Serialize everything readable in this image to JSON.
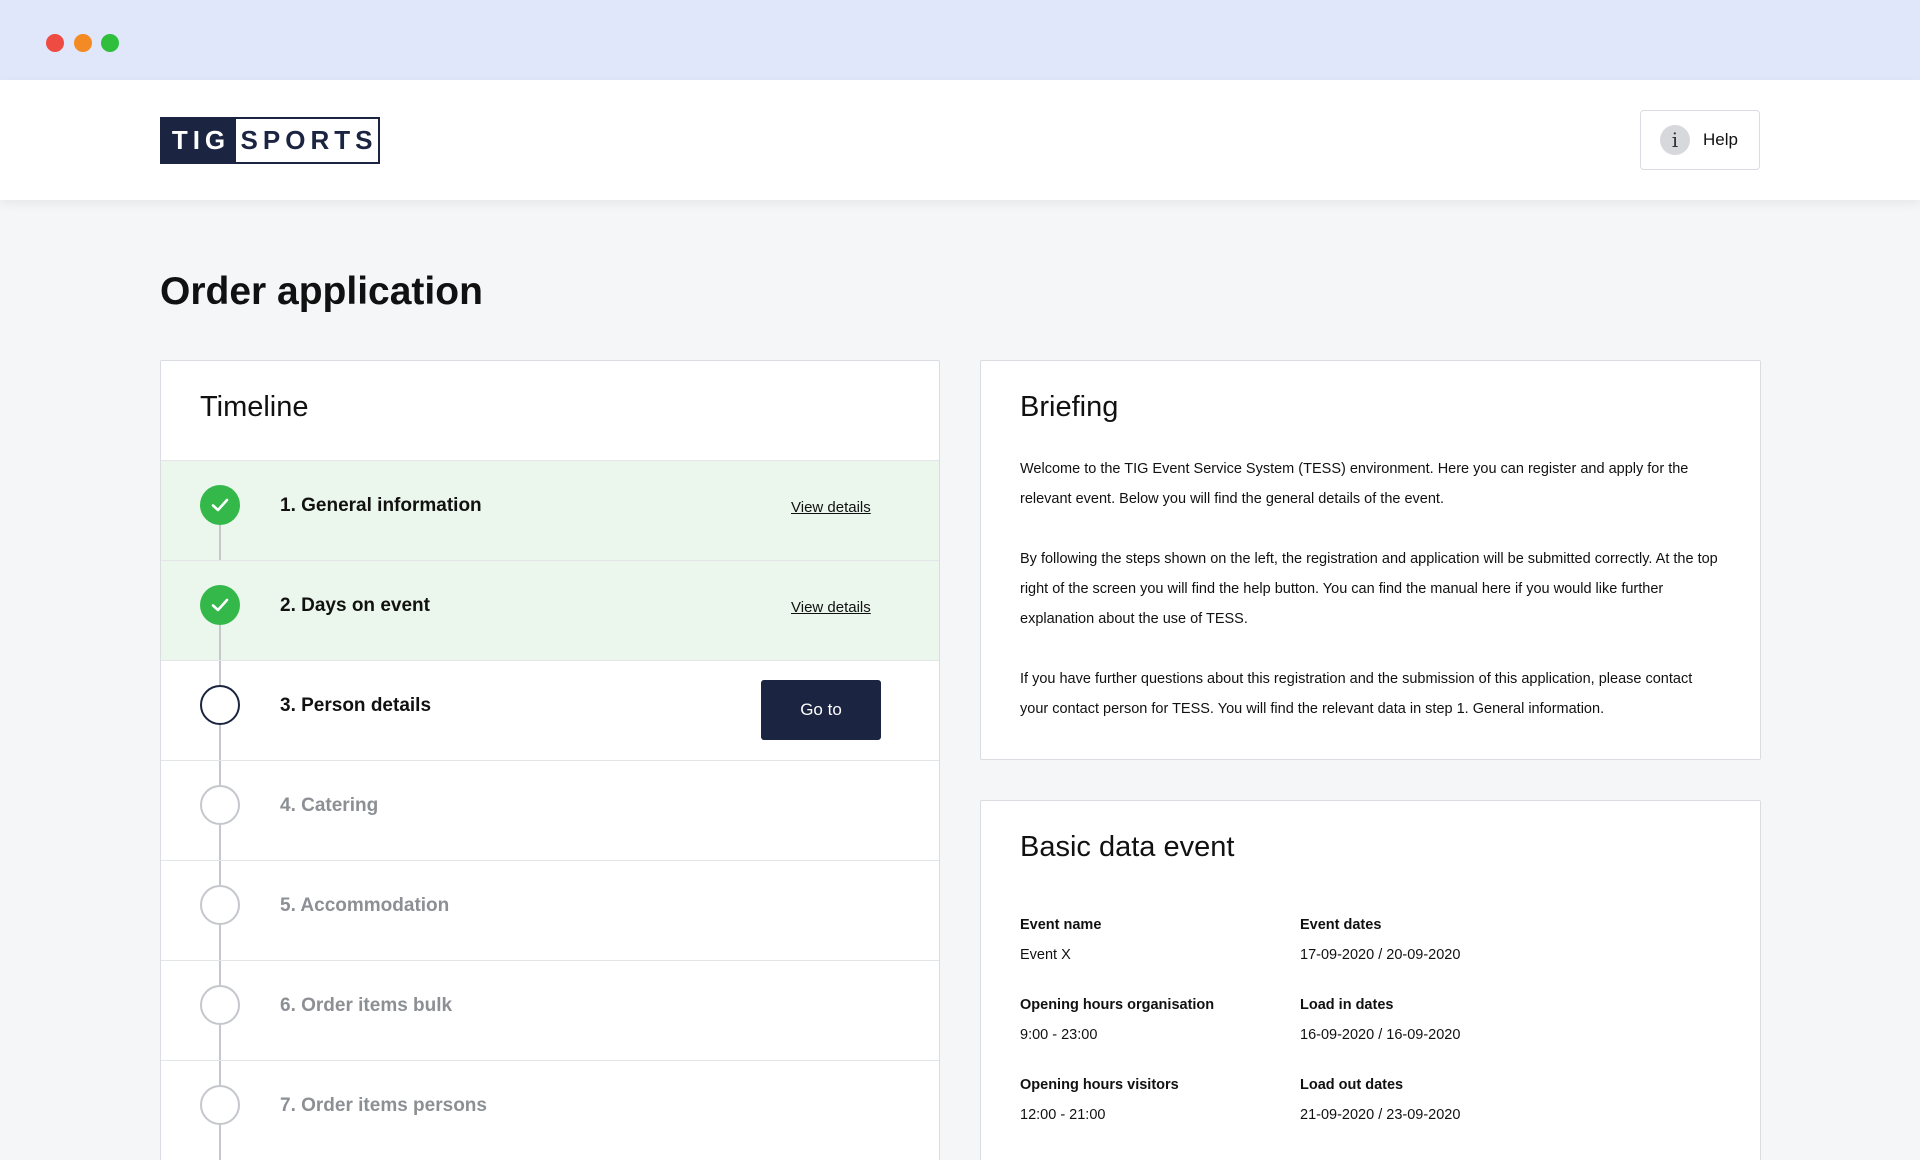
{
  "logo": {
    "left": "TIG",
    "right": "SPORTS"
  },
  "header": {
    "help_label": "Help",
    "help_icon": "info-icon"
  },
  "page_title": "Order application",
  "timeline": {
    "title": "Timeline",
    "steps": [
      {
        "label": "1. General information",
        "status": "done",
        "action": "View details"
      },
      {
        "label": "2. Days on event",
        "status": "done",
        "action": "View details"
      },
      {
        "label": "3. Person details",
        "status": "current",
        "action": "Go to"
      },
      {
        "label": "4. Catering",
        "status": "pending"
      },
      {
        "label": "5. Accommodation",
        "status": "pending"
      },
      {
        "label": "6. Order items bulk",
        "status": "pending"
      },
      {
        "label": "7. Order items persons",
        "status": "pending"
      }
    ]
  },
  "briefing": {
    "title": "Briefing",
    "paragraphs": [
      "Welcome to the TIG Event Service System (TESS) environment. Here you can register and apply for the relevant event. Below you will find the general details of the event.",
      "By following the steps shown on the left, the registration and application will be submitted correctly. At the top right of the screen you will find the help button. You can find the manual here if you would like further explanation about the use of TESS.",
      "If you have further questions about this registration and the submission of this application, please contact your contact person for TESS. You will find the relevant data in step 1. General information."
    ]
  },
  "basic_data": {
    "title": "Basic data event",
    "fields": [
      {
        "label": "Event name",
        "value": "Event X"
      },
      {
        "label": "Event dates",
        "value": "17-09-2020 / 20-09-2020"
      },
      {
        "label": "Opening hours organisation",
        "value": "9:00 - 23:00"
      },
      {
        "label": "Load in dates",
        "value": "16-09-2020 / 16-09-2020"
      },
      {
        "label": "Opening hours visitors",
        "value": "12:00 - 21:00"
      },
      {
        "label": "Load out dates",
        "value": "21-09-2020 / 23-09-2020"
      }
    ]
  },
  "colors": {
    "brand_navy": "#1b2440",
    "done_green": "#34b84a",
    "done_row_bg": "#ebf7ec",
    "chrome_bg": "#e0e7fa"
  }
}
